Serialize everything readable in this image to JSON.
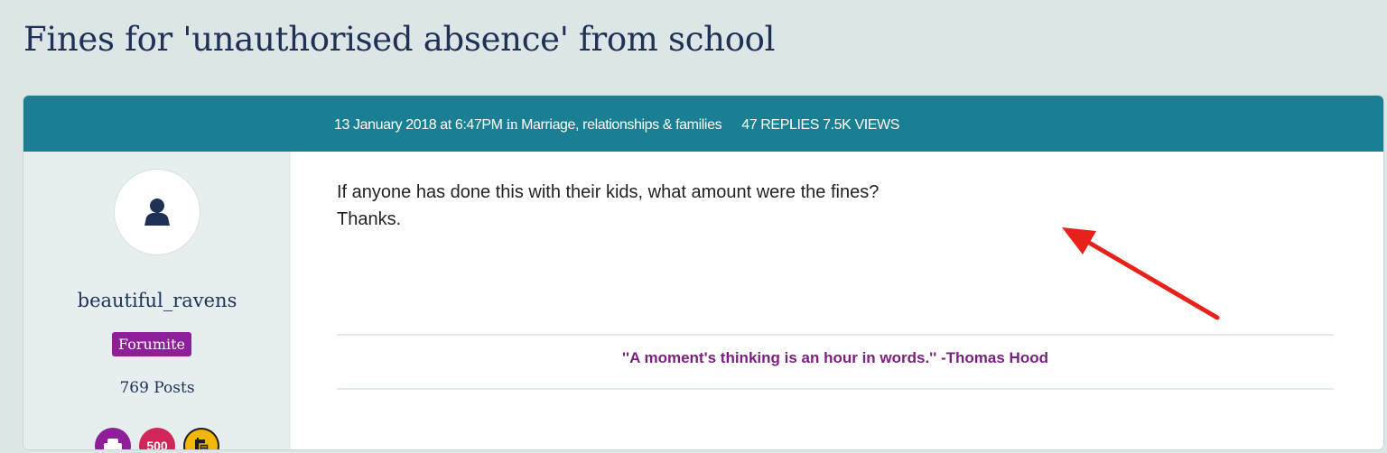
{
  "thread": {
    "title": "Fines for 'unauthorised absence' from school"
  },
  "post": {
    "date": "13 January 2018 at 6:47PM",
    "in_word": "in",
    "category": "Marriage, relationships & families",
    "stats": "47 REPLIES 7.5K VIEWS",
    "body_line1": "If anyone has done this with their kids, what amount were the fines?",
    "body_line2": "Thanks.",
    "signature": "''A moment's thinking is an hour in words.'' -Thomas Hood"
  },
  "author": {
    "username": "beautiful_ravens",
    "role": "Forumite",
    "posts": "769 Posts",
    "badges": [
      {
        "icon": "armchair-icon",
        "color": "#8f1f98"
      },
      {
        "label": "500",
        "color": "#d1265a"
      },
      {
        "icon": "notepad-icon",
        "color": "#f2b705"
      }
    ]
  },
  "colors": {
    "header": "#1a7f92",
    "title": "#1f3155",
    "arrow": "#e8221b"
  }
}
